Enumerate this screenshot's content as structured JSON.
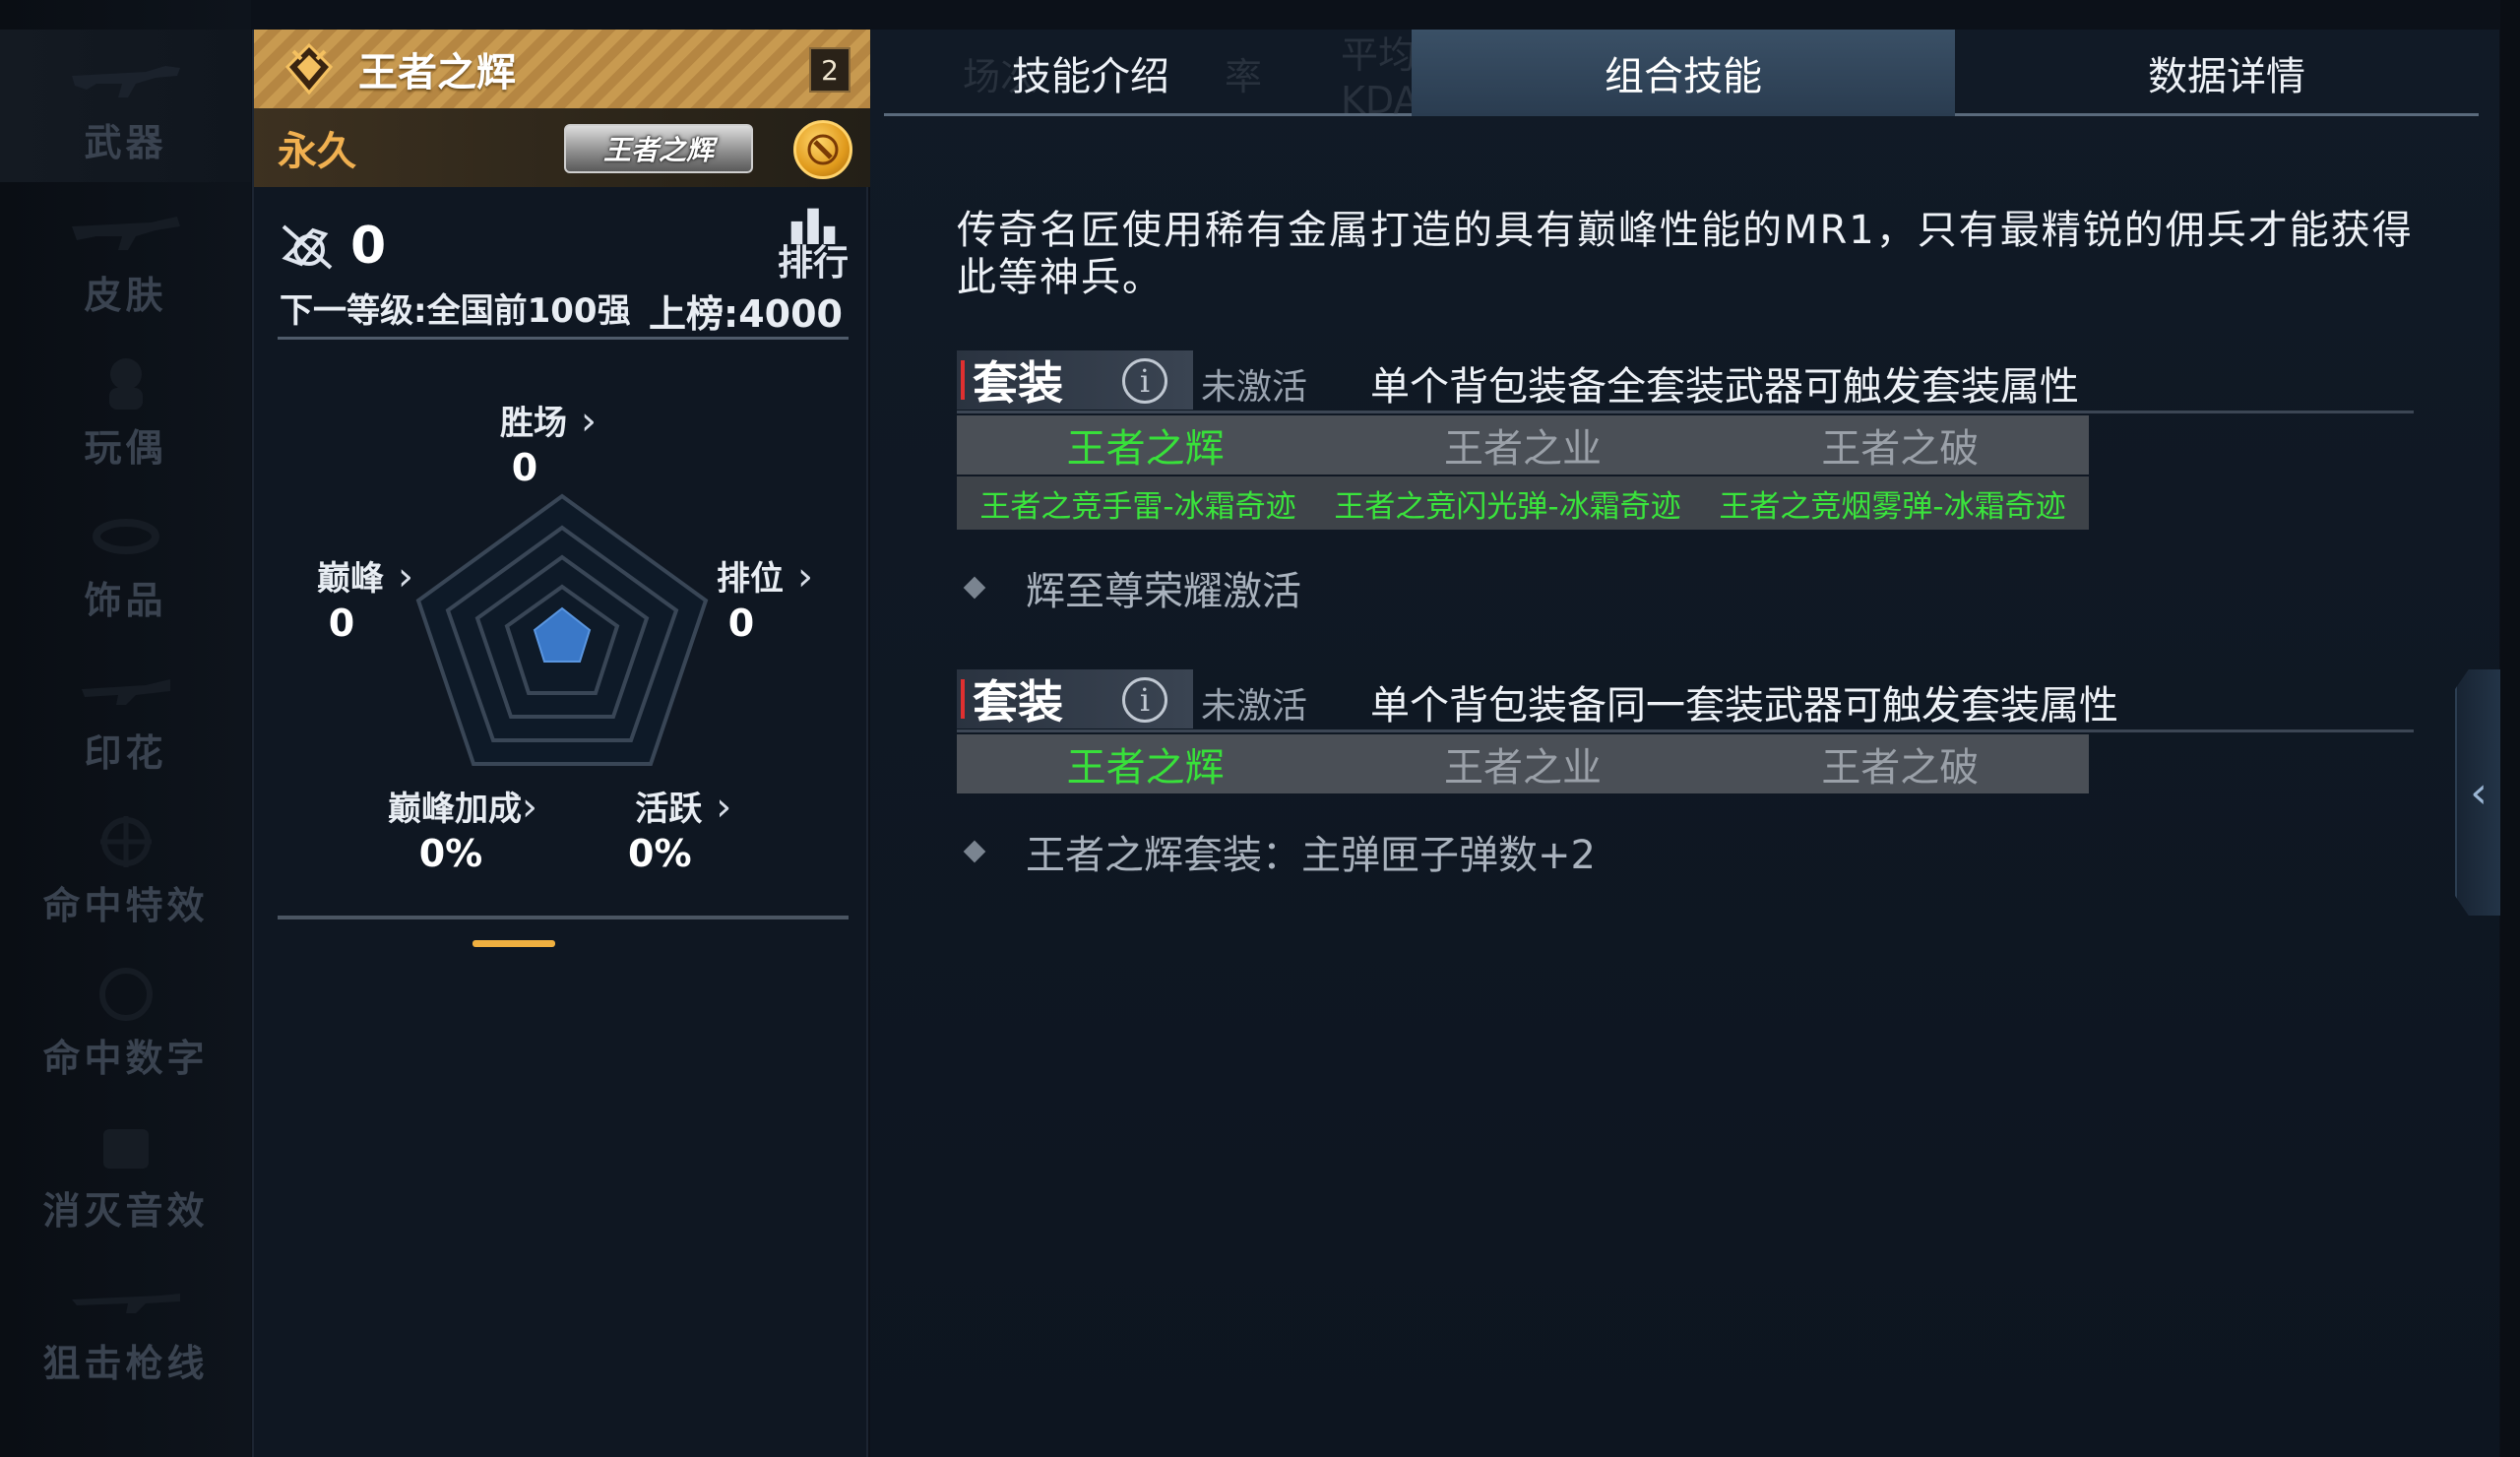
{
  "sidebar": {
    "items": [
      {
        "label": "武器",
        "icon": "rifle-icon",
        "active": true
      },
      {
        "label": "皮肤",
        "icon": "rifle-skin-icon",
        "active": false
      },
      {
        "label": "玩偶",
        "icon": "doll-icon",
        "active": false
      },
      {
        "label": "饰品",
        "icon": "ornament-icon",
        "active": false
      },
      {
        "label": "印花",
        "icon": "decal-icon",
        "active": false
      },
      {
        "label": "命中特效",
        "icon": "crosshair-icon",
        "active": false
      },
      {
        "label": "命中数字",
        "icon": "number-icon",
        "active": false
      },
      {
        "label": "消灭音效",
        "icon": "sound-icon",
        "active": false
      },
      {
        "label": "狙击枪线",
        "icon": "sniper-icon",
        "active": false
      }
    ]
  },
  "card": {
    "name": "王者之辉",
    "level": "2",
    "duration": "永久",
    "title_plate": "王者之辉",
    "kills": "0",
    "rank_label": "排行",
    "next_level": "下一等级:全国前100强",
    "on_board": "上榜:4000",
    "stats": {
      "wins": {
        "label": "胜场",
        "value": "0"
      },
      "peak": {
        "label": "巅峰",
        "value": "0"
      },
      "ranked": {
        "label": "排位",
        "value": "0"
      },
      "peak_bonus": {
        "label": "巅峰加成",
        "value": "0%"
      },
      "active": {
        "label": "活跃",
        "value": "0%"
      }
    }
  },
  "tabs": [
    {
      "label": "技能介绍",
      "ghost": "场次",
      "ghost2": "率",
      "active": false
    },
    {
      "label": "组合技能",
      "ghost": "平均KDA",
      "active": true
    },
    {
      "label": "数据详情",
      "active": false
    }
  ],
  "description": "传奇名匠使用稀有金属打造的具有巅峰性能的MR1，只有最精锐的佣兵才能获得此等神兵。",
  "sets": [
    {
      "tag": "套装",
      "status": "未激活",
      "desc": "单个背包装备全套装武器可触发套装属性",
      "suits": [
        "王者之辉",
        "王者之业",
        "王者之破"
      ],
      "active_suit": 0,
      "items": [
        "王者之竞手雷-冰霜奇迹",
        "王者之竞闪光弹-冰霜奇迹",
        "王者之竞烟雾弹-冰霜奇迹"
      ],
      "bonus": "辉至尊荣耀激活"
    },
    {
      "tag": "套装",
      "status": "未激活",
      "desc": "单个背包装备同一套装武器可触发套装属性",
      "suits": [
        "王者之辉",
        "王者之业",
        "王者之破"
      ],
      "active_suit": 0,
      "items": [],
      "bonus": "王者之辉套装：主弹匣子弹数+2"
    }
  ],
  "colors": {
    "accent_gold": "#c89a50",
    "suit_active_green": "#38e03a",
    "tab_active": "#2a3c50"
  }
}
